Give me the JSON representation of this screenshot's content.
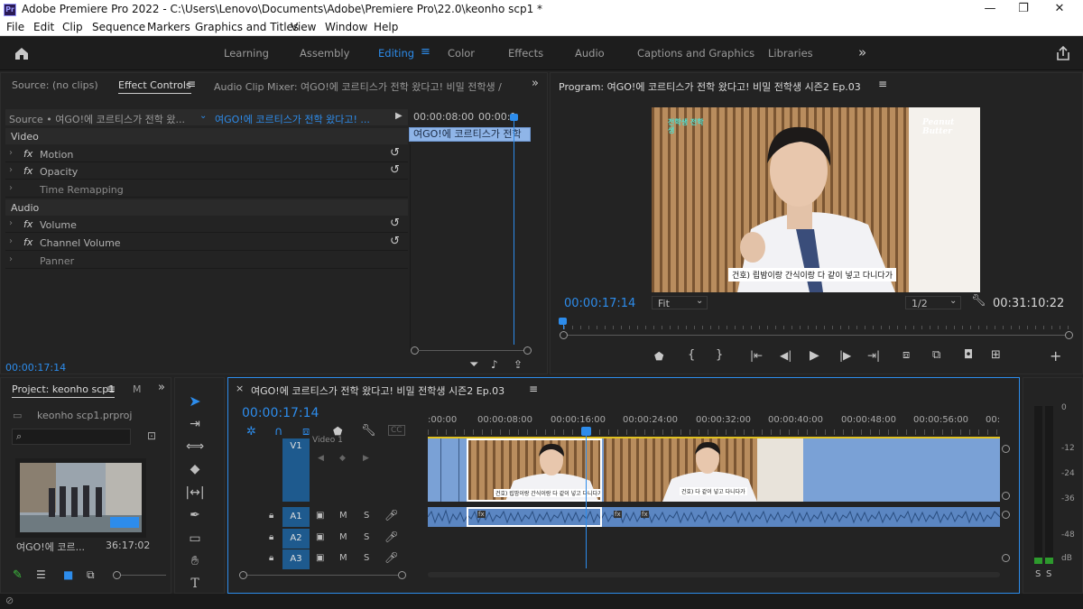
{
  "window": {
    "title": "Adobe Premiere Pro 2022 - C:\\Users\\Lenovo\\Documents\\Adobe\\Premiere Pro\\22.0\\keonho scp1 *",
    "minimize": "—",
    "maximize": "❐",
    "close": "✕"
  },
  "menu": [
    "File",
    "Edit",
    "Clip",
    "Sequence",
    "Markers",
    "Graphics and Titles",
    "View",
    "Window",
    "Help"
  ],
  "workspaces": {
    "items": [
      "Learning",
      "Assembly",
      "Editing",
      "Color",
      "Effects",
      "Audio",
      "Captions and Graphics",
      "Libraries"
    ],
    "active": "Editing",
    "more": "»"
  },
  "source_panel": {
    "tabs": [
      "Source: (no clips)",
      "Effect Controls",
      "Audio Clip Mixer: 여GO!에 코르티스가 전학 왔다고! 비밀 전학생 /"
    ],
    "more": "»",
    "source_label": "Source • 여GO!에 코르티스가 전학 왔...",
    "sequence_label": "여GO!에 코르티스가 전학 왔다고! ...",
    "mini_timecodes": [
      "00:00:08:00",
      "00:00:1"
    ],
    "mini_clip": "여GO!에 코르티스가 전학",
    "sections": {
      "video": "Video",
      "audio": "Audio"
    },
    "effects": [
      {
        "name": "Motion",
        "fx": "fx",
        "resettable": true
      },
      {
        "name": "Opacity",
        "fx": "fx",
        "resettable": true
      },
      {
        "name": "Time Remapping",
        "fx": "",
        "resettable": false
      },
      {
        "name": "Volume",
        "fx": "fx",
        "resettable": true
      },
      {
        "name": "Channel Volume",
        "fx": "fx",
        "resettable": true
      },
      {
        "name": "Panner",
        "fx": "",
        "resettable": false
      }
    ],
    "timecode": "00:00:17:14"
  },
  "program_monitor": {
    "title": "Program: 여GO!에 코르티스가 전학 왔다고! 비밀 전학생 시즌2 Ep.03",
    "timecode": "00:00:17:14",
    "fit": "Fit",
    "resolution": "1/2",
    "duration": "00:31:10:22",
    "video_logo_left": "전학생 전학생",
    "video_logo_right": "Peanut Butter",
    "subtitle": "건호) 립밤이랑 간식이랑 다 같이 넣고 다니다가"
  },
  "project_panel": {
    "title": "Project: keonho scp1",
    "more": "»",
    "file": "keonho scp1.prproj",
    "clip_name": "여GO!에 코르...",
    "clip_duration": "36:17:02"
  },
  "timeline": {
    "title": "여GO!에 코르티스가 전학 왔다고! 비밀 전학생 시즌2 Ep.03",
    "timecode": "00:00:17:14",
    "ruler": [
      ":00:00",
      "00:00:08:00",
      "00:00:16:00",
      "00:00:24:00",
      "00:00:32:00",
      "00:00:40:00",
      "00:00:48:00",
      "00:00:56:00",
      "00:0"
    ],
    "video_track": {
      "label": "V1",
      "name": "Video 1"
    },
    "audio_tracks": [
      "A1",
      "A2",
      "A3"
    ],
    "track_m": "M",
    "track_s": "S",
    "clip_subtitle_1": "건호) 립밤이랑 간식이랑 다 같이 넣고 다니다가",
    "clip_subtitle_2": "건호) 다 같이 넣고 다니다가"
  },
  "meter": {
    "labels": [
      "0",
      "-12",
      "-24",
      "-36",
      "-48",
      "dB"
    ],
    "solo": [
      "S",
      "S"
    ]
  }
}
